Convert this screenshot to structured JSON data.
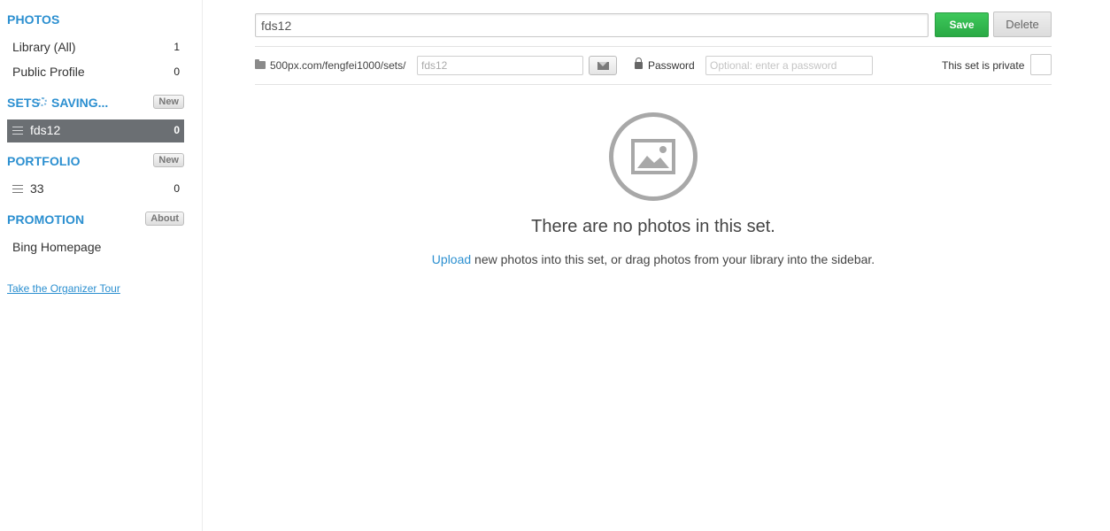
{
  "sidebar": {
    "photos": {
      "heading": "PHOTOS",
      "items": [
        {
          "label": "Library (All)",
          "count": "1"
        },
        {
          "label": "Public Profile",
          "count": "0"
        }
      ]
    },
    "sets": {
      "heading": "SETS",
      "saving": "SAVING...",
      "new_label": "New",
      "items": [
        {
          "label": "fds12",
          "count": "0",
          "selected": true
        }
      ]
    },
    "portfolio": {
      "heading": "PORTFOLIO",
      "new_label": "New",
      "items": [
        {
          "label": "33",
          "count": "0"
        }
      ]
    },
    "promotion": {
      "heading": "PROMOTION",
      "about_label": "About",
      "items": [
        {
          "label": "Bing Homepage"
        }
      ]
    },
    "tour_link": "Take the Organizer Tour"
  },
  "editor": {
    "title_value": "fds12",
    "save_label": "Save",
    "delete_label": "Delete",
    "url_prefix": "500px.com/fengfei1000/sets/",
    "slug_value": "fds12",
    "password_label": "Password",
    "password_placeholder": "Optional: enter a password",
    "private_label": "This set is private",
    "private_checked": false
  },
  "empty_state": {
    "message": "There are no photos in this set.",
    "upload_link": "Upload",
    "hint_rest": " new photos into this set, or drag photos from your library into the sidebar."
  },
  "colors": {
    "accent": "#2b8fd0",
    "save_green": "#2fb84d",
    "selected_bg": "#6b6f73"
  },
  "icons": [
    "list-icon",
    "spinner-icon",
    "folder-icon",
    "mail-icon",
    "lock-icon",
    "image-placeholder-icon"
  ]
}
